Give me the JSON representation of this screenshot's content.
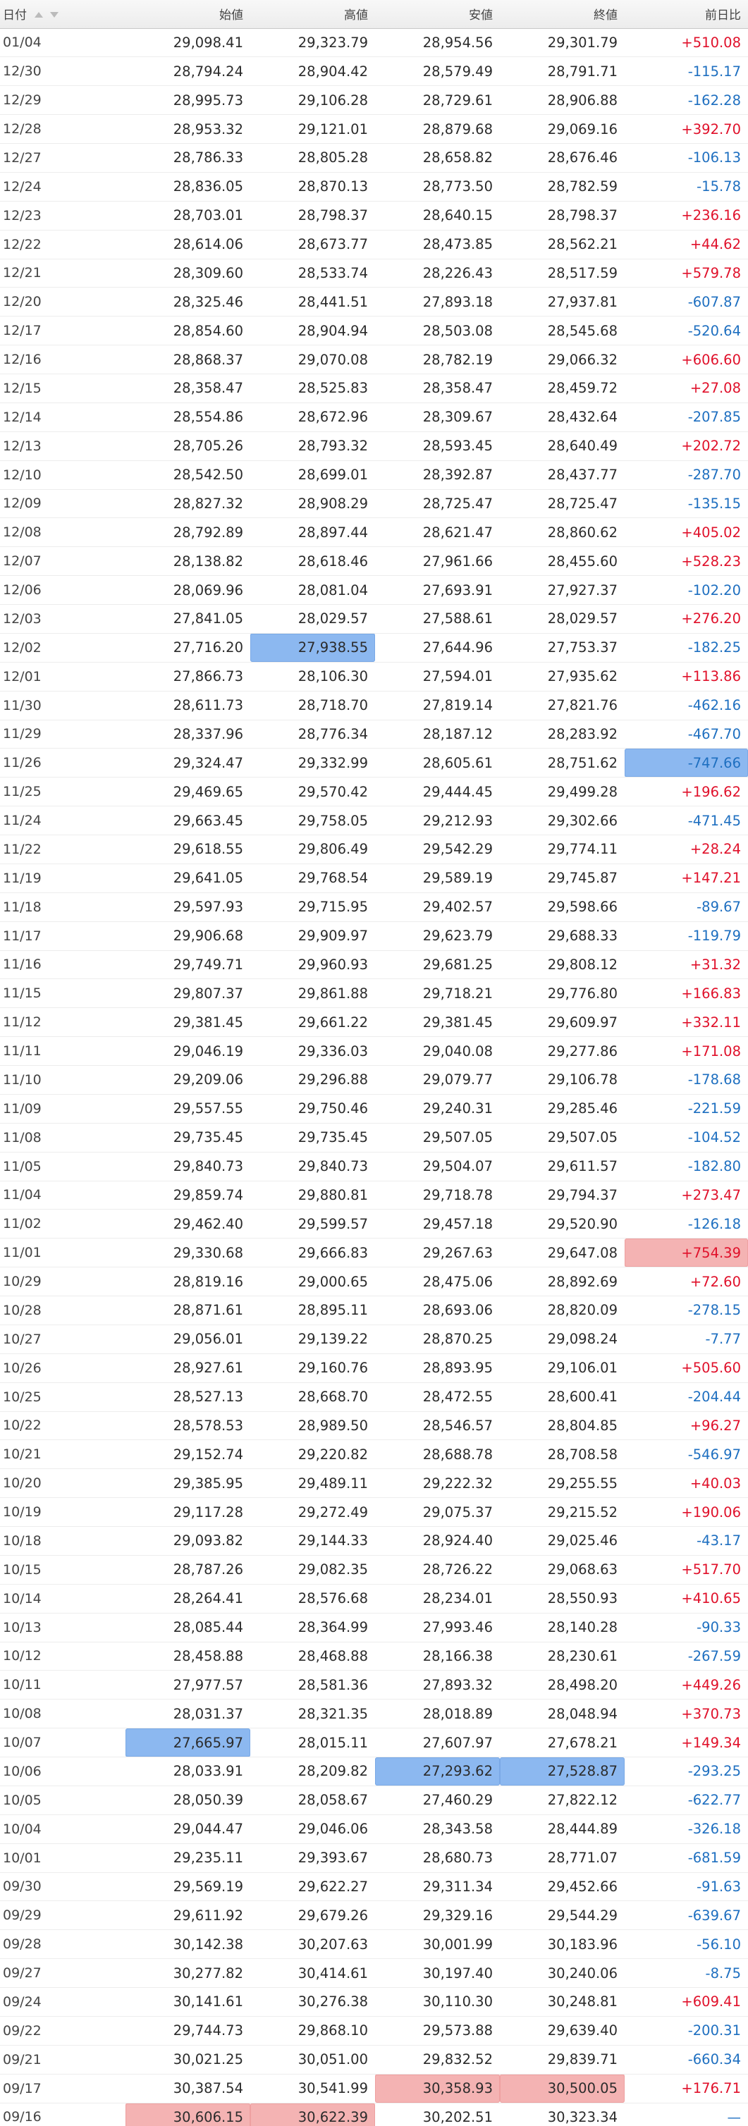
{
  "table": {
    "headers": {
      "date": "日付",
      "open": "始値",
      "high": "高値",
      "low": "安値",
      "close": "終値",
      "change": "前日比"
    },
    "sort_icons": [
      "sort-ascending-icon",
      "sort-descending-icon"
    ],
    "highlight_colors": {
      "min": "#8cb8f0",
      "max": "#f4b3b3",
      "up": "#e0102a",
      "down": "#1e6fc0"
    },
    "rows": [
      {
        "date": "01/04",
        "open": "29,098.41",
        "high": "29,323.79",
        "low": "28,954.56",
        "close": "29,301.79",
        "change": "+510.08"
      },
      {
        "date": "12/30",
        "open": "28,794.24",
        "high": "28,904.42",
        "low": "28,579.49",
        "close": "28,791.71",
        "change": "-115.17"
      },
      {
        "date": "12/29",
        "open": "28,995.73",
        "high": "29,106.28",
        "low": "28,729.61",
        "close": "28,906.88",
        "change": "-162.28"
      },
      {
        "date": "12/28",
        "open": "28,953.32",
        "high": "29,121.01",
        "low": "28,879.68",
        "close": "29,069.16",
        "change": "+392.70"
      },
      {
        "date": "12/27",
        "open": "28,786.33",
        "high": "28,805.28",
        "low": "28,658.82",
        "close": "28,676.46",
        "change": "-106.13"
      },
      {
        "date": "12/24",
        "open": "28,836.05",
        "high": "28,870.13",
        "low": "28,773.50",
        "close": "28,782.59",
        "change": "-15.78"
      },
      {
        "date": "12/23",
        "open": "28,703.01",
        "high": "28,798.37",
        "low": "28,640.15",
        "close": "28,798.37",
        "change": "+236.16"
      },
      {
        "date": "12/22",
        "open": "28,614.06",
        "high": "28,673.77",
        "low": "28,473.85",
        "close": "28,562.21",
        "change": "+44.62"
      },
      {
        "date": "12/21",
        "open": "28,309.60",
        "high": "28,533.74",
        "low": "28,226.43",
        "close": "28,517.59",
        "change": "+579.78"
      },
      {
        "date": "12/20",
        "open": "28,325.46",
        "high": "28,441.51",
        "low": "27,893.18",
        "close": "27,937.81",
        "change": "-607.87"
      },
      {
        "date": "12/17",
        "open": "28,854.60",
        "high": "28,904.94",
        "low": "28,503.08",
        "close": "28,545.68",
        "change": "-520.64"
      },
      {
        "date": "12/16",
        "open": "28,868.37",
        "high": "29,070.08",
        "low": "28,782.19",
        "close": "29,066.32",
        "change": "+606.60"
      },
      {
        "date": "12/15",
        "open": "28,358.47",
        "high": "28,525.83",
        "low": "28,358.47",
        "close": "28,459.72",
        "change": "+27.08"
      },
      {
        "date": "12/14",
        "open": "28,554.86",
        "high": "28,672.96",
        "low": "28,309.67",
        "close": "28,432.64",
        "change": "-207.85"
      },
      {
        "date": "12/13",
        "open": "28,705.26",
        "high": "28,793.32",
        "low": "28,593.45",
        "close": "28,640.49",
        "change": "+202.72"
      },
      {
        "date": "12/10",
        "open": "28,542.50",
        "high": "28,699.01",
        "low": "28,392.87",
        "close": "28,437.77",
        "change": "-287.70"
      },
      {
        "date": "12/09",
        "open": "28,827.32",
        "high": "28,908.29",
        "low": "28,725.47",
        "close": "28,725.47",
        "change": "-135.15"
      },
      {
        "date": "12/08",
        "open": "28,792.89",
        "high": "28,897.44",
        "low": "28,621.47",
        "close": "28,860.62",
        "change": "+405.02"
      },
      {
        "date": "12/07",
        "open": "28,138.82",
        "high": "28,618.46",
        "low": "27,961.66",
        "close": "28,455.60",
        "change": "+528.23"
      },
      {
        "date": "12/06",
        "open": "28,069.96",
        "high": "28,081.04",
        "low": "27,693.91",
        "close": "27,927.37",
        "change": "-102.20"
      },
      {
        "date": "12/03",
        "open": "27,841.05",
        "high": "28,029.57",
        "low": "27,588.61",
        "close": "28,029.57",
        "change": "+276.20"
      },
      {
        "date": "12/02",
        "open": "27,716.20",
        "high": "27,938.55",
        "low": "27,644.96",
        "close": "27,753.37",
        "change": "-182.25"
      },
      {
        "date": "12/01",
        "open": "27,866.73",
        "high": "28,106.30",
        "low": "27,594.01",
        "close": "27,935.62",
        "change": "+113.86"
      },
      {
        "date": "11/30",
        "open": "28,611.73",
        "high": "28,718.70",
        "low": "27,819.14",
        "close": "27,821.76",
        "change": "-462.16"
      },
      {
        "date": "11/29",
        "open": "28,337.96",
        "high": "28,776.34",
        "low": "28,187.12",
        "close": "28,283.92",
        "change": "-467.70"
      },
      {
        "date": "11/26",
        "open": "29,324.47",
        "high": "29,332.99",
        "low": "28,605.61",
        "close": "28,751.62",
        "change": "-747.66"
      },
      {
        "date": "11/25",
        "open": "29,469.65",
        "high": "29,570.42",
        "low": "29,444.45",
        "close": "29,499.28",
        "change": "+196.62"
      },
      {
        "date": "11/24",
        "open": "29,663.45",
        "high": "29,758.05",
        "low": "29,212.93",
        "close": "29,302.66",
        "change": "-471.45"
      },
      {
        "date": "11/22",
        "open": "29,618.55",
        "high": "29,806.49",
        "low": "29,542.29",
        "close": "29,774.11",
        "change": "+28.24"
      },
      {
        "date": "11/19",
        "open": "29,641.05",
        "high": "29,768.54",
        "low": "29,589.19",
        "close": "29,745.87",
        "change": "+147.21"
      },
      {
        "date": "11/18",
        "open": "29,597.93",
        "high": "29,715.95",
        "low": "29,402.57",
        "close": "29,598.66",
        "change": "-89.67"
      },
      {
        "date": "11/17",
        "open": "29,906.68",
        "high": "29,909.97",
        "low": "29,623.79",
        "close": "29,688.33",
        "change": "-119.79"
      },
      {
        "date": "11/16",
        "open": "29,749.71",
        "high": "29,960.93",
        "low": "29,681.25",
        "close": "29,808.12",
        "change": "+31.32"
      },
      {
        "date": "11/15",
        "open": "29,807.37",
        "high": "29,861.88",
        "low": "29,718.21",
        "close": "29,776.80",
        "change": "+166.83"
      },
      {
        "date": "11/12",
        "open": "29,381.45",
        "high": "29,661.22",
        "low": "29,381.45",
        "close": "29,609.97",
        "change": "+332.11"
      },
      {
        "date": "11/11",
        "open": "29,046.19",
        "high": "29,336.03",
        "low": "29,040.08",
        "close": "29,277.86",
        "change": "+171.08"
      },
      {
        "date": "11/10",
        "open": "29,209.06",
        "high": "29,296.88",
        "low": "29,079.77",
        "close": "29,106.78",
        "change": "-178.68"
      },
      {
        "date": "11/09",
        "open": "29,557.55",
        "high": "29,750.46",
        "low": "29,240.31",
        "close": "29,285.46",
        "change": "-221.59"
      },
      {
        "date": "11/08",
        "open": "29,735.45",
        "high": "29,735.45",
        "low": "29,507.05",
        "close": "29,507.05",
        "change": "-104.52"
      },
      {
        "date": "11/05",
        "open": "29,840.73",
        "high": "29,840.73",
        "low": "29,504.07",
        "close": "29,611.57",
        "change": "-182.80"
      },
      {
        "date": "11/04",
        "open": "29,859.74",
        "high": "29,880.81",
        "low": "29,718.78",
        "close": "29,794.37",
        "change": "+273.47"
      },
      {
        "date": "11/02",
        "open": "29,462.40",
        "high": "29,599.57",
        "low": "29,457.18",
        "close": "29,520.90",
        "change": "-126.18"
      },
      {
        "date": "11/01",
        "open": "29,330.68",
        "high": "29,666.83",
        "low": "29,267.63",
        "close": "29,647.08",
        "change": "+754.39"
      },
      {
        "date": "10/29",
        "open": "28,819.16",
        "high": "29,000.65",
        "low": "28,475.06",
        "close": "28,892.69",
        "change": "+72.60"
      },
      {
        "date": "10/28",
        "open": "28,871.61",
        "high": "28,895.11",
        "low": "28,693.06",
        "close": "28,820.09",
        "change": "-278.15"
      },
      {
        "date": "10/27",
        "open": "29,056.01",
        "high": "29,139.22",
        "low": "28,870.25",
        "close": "29,098.24",
        "change": "-7.77"
      },
      {
        "date": "10/26",
        "open": "28,927.61",
        "high": "29,160.76",
        "low": "28,893.95",
        "close": "29,106.01",
        "change": "+505.60"
      },
      {
        "date": "10/25",
        "open": "28,527.13",
        "high": "28,668.70",
        "low": "28,472.55",
        "close": "28,600.41",
        "change": "-204.44"
      },
      {
        "date": "10/22",
        "open": "28,578.53",
        "high": "28,989.50",
        "low": "28,546.57",
        "close": "28,804.85",
        "change": "+96.27"
      },
      {
        "date": "10/21",
        "open": "29,152.74",
        "high": "29,220.82",
        "low": "28,688.78",
        "close": "28,708.58",
        "change": "-546.97"
      },
      {
        "date": "10/20",
        "open": "29,385.95",
        "high": "29,489.11",
        "low": "29,222.32",
        "close": "29,255.55",
        "change": "+40.03"
      },
      {
        "date": "10/19",
        "open": "29,117.28",
        "high": "29,272.49",
        "low": "29,075.37",
        "close": "29,215.52",
        "change": "+190.06"
      },
      {
        "date": "10/18",
        "open": "29,093.82",
        "high": "29,144.33",
        "low": "28,924.40",
        "close": "29,025.46",
        "change": "-43.17"
      },
      {
        "date": "10/15",
        "open": "28,787.26",
        "high": "29,082.35",
        "low": "28,726.22",
        "close": "29,068.63",
        "change": "+517.70"
      },
      {
        "date": "10/14",
        "open": "28,264.41",
        "high": "28,576.68",
        "low": "28,234.01",
        "close": "28,550.93",
        "change": "+410.65"
      },
      {
        "date": "10/13",
        "open": "28,085.44",
        "high": "28,364.99",
        "low": "27,993.46",
        "close": "28,140.28",
        "change": "-90.33"
      },
      {
        "date": "10/12",
        "open": "28,458.88",
        "high": "28,468.88",
        "low": "28,166.38",
        "close": "28,230.61",
        "change": "-267.59"
      },
      {
        "date": "10/11",
        "open": "27,977.57",
        "high": "28,581.36",
        "low": "27,893.32",
        "close": "28,498.20",
        "change": "+449.26"
      },
      {
        "date": "10/08",
        "open": "28,031.37",
        "high": "28,321.35",
        "low": "28,018.89",
        "close": "28,048.94",
        "change": "+370.73"
      },
      {
        "date": "10/07",
        "open": "27,665.97",
        "high": "28,015.11",
        "low": "27,607.97",
        "close": "27,678.21",
        "change": "+149.34"
      },
      {
        "date": "10/06",
        "open": "28,033.91",
        "high": "28,209.82",
        "low": "27,293.62",
        "close": "27,528.87",
        "change": "-293.25"
      },
      {
        "date": "10/05",
        "open": "28,050.39",
        "high": "28,058.67",
        "low": "27,460.29",
        "close": "27,822.12",
        "change": "-622.77"
      },
      {
        "date": "10/04",
        "open": "29,044.47",
        "high": "29,046.06",
        "low": "28,343.58",
        "close": "28,444.89",
        "change": "-326.18"
      },
      {
        "date": "10/01",
        "open": "29,235.11",
        "high": "29,393.67",
        "low": "28,680.73",
        "close": "28,771.07",
        "change": "-681.59"
      },
      {
        "date": "09/30",
        "open": "29,569.19",
        "high": "29,622.27",
        "low": "29,311.34",
        "close": "29,452.66",
        "change": "-91.63"
      },
      {
        "date": "09/29",
        "open": "29,611.92",
        "high": "29,679.26",
        "low": "29,329.16",
        "close": "29,544.29",
        "change": "-639.67"
      },
      {
        "date": "09/28",
        "open": "30,142.38",
        "high": "30,207.63",
        "low": "30,001.99",
        "close": "30,183.96",
        "change": "-56.10"
      },
      {
        "date": "09/27",
        "open": "30,277.82",
        "high": "30,414.61",
        "low": "30,197.40",
        "close": "30,240.06",
        "change": "-8.75"
      },
      {
        "date": "09/24",
        "open": "30,141.61",
        "high": "30,276.38",
        "low": "30,110.30",
        "close": "30,248.81",
        "change": "+609.41"
      },
      {
        "date": "09/22",
        "open": "29,744.73",
        "high": "29,868.10",
        "low": "29,573.88",
        "close": "29,639.40",
        "change": "-200.31"
      },
      {
        "date": "09/21",
        "open": "30,021.25",
        "high": "30,051.00",
        "low": "29,832.52",
        "close": "29,839.71",
        "change": "-660.34"
      },
      {
        "date": "09/17",
        "open": "30,387.54",
        "high": "30,541.99",
        "low": "30,358.93",
        "close": "30,500.05",
        "change": "+176.71"
      },
      {
        "date": "09/16",
        "open": "30,606.15",
        "high": "30,622.39",
        "low": "30,202.51",
        "close": "30,323.34",
        "change": "—"
      }
    ],
    "highlights_min": [
      {
        "date": "12/02",
        "col": "high"
      },
      {
        "date": "11/26",
        "col": "change"
      },
      {
        "date": "10/07",
        "col": "open"
      },
      {
        "date": "10/06",
        "col": "low"
      },
      {
        "date": "10/06",
        "col": "close"
      }
    ],
    "highlights_max": [
      {
        "date": "11/01",
        "col": "change"
      },
      {
        "date": "09/17",
        "col": "low"
      },
      {
        "date": "09/17",
        "col": "close"
      },
      {
        "date": "09/16",
        "col": "open"
      },
      {
        "date": "09/16",
        "col": "high"
      }
    ]
  }
}
